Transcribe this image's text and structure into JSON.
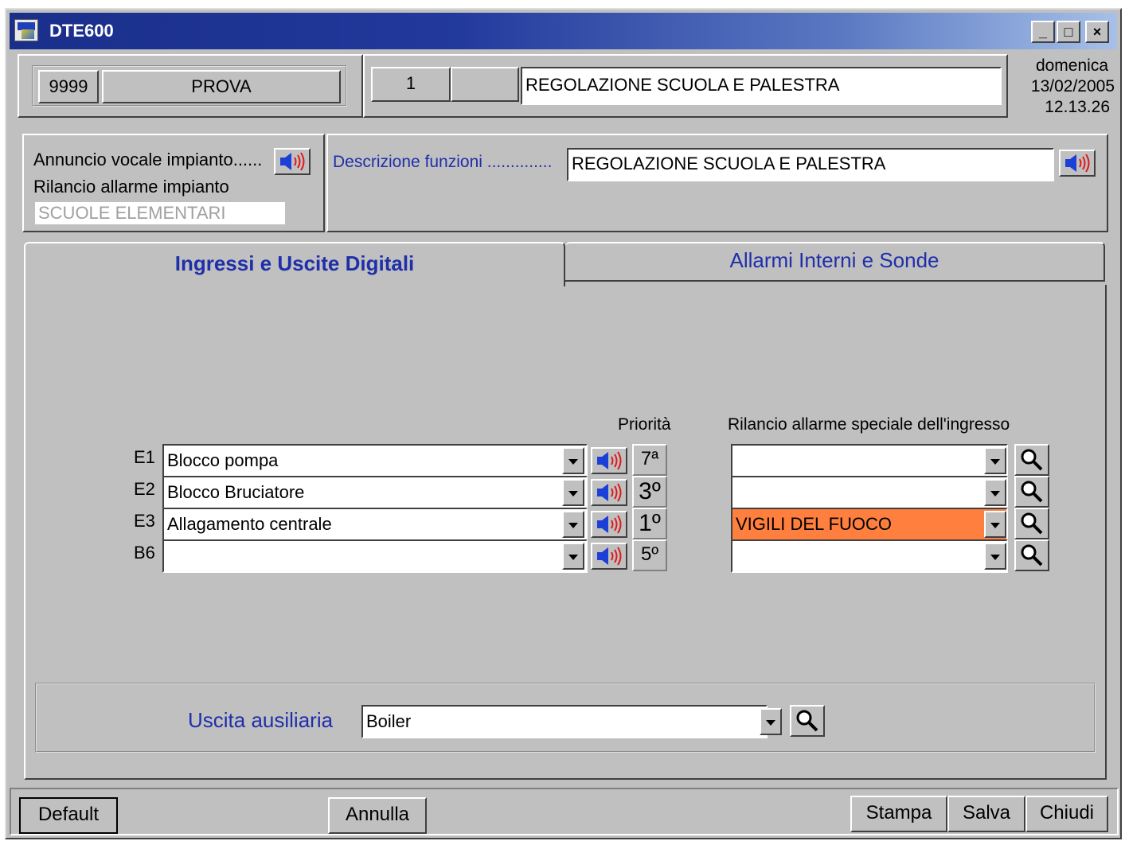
{
  "window": {
    "title": "DTE600",
    "minimize": "_",
    "maximize": "□",
    "close": "×"
  },
  "header": {
    "code": "9999",
    "name": "PROVA",
    "number": "1",
    "empty_field": "",
    "description": "REGOLAZIONE SCUOLA E PALESTRA",
    "day": "domenica",
    "date": "13/02/2005",
    "time": "12.13.26"
  },
  "info": {
    "voice_label": "Annuncio vocale impianto......",
    "relay_label": "Rilancio allarme impianto",
    "relay_value": "SCUOLE ELEMENTARI",
    "func_label": "Descrizione funzioni ..............",
    "func_value": "REGOLAZIONE SCUOLA E PALESTRA"
  },
  "tabs": [
    {
      "label": "Ingressi e Uscite Digitali",
      "active": true
    },
    {
      "label": "Allarmi Interni e Sonde",
      "active": false
    }
  ],
  "inputs": {
    "priority_header": "Priorità",
    "special_header": "Rilancio allarme speciale dell'ingresso",
    "rows": [
      {
        "id": "E1",
        "value": "Blocco pompa",
        "priority": "7ª",
        "special": ""
      },
      {
        "id": "E2",
        "value": "Blocco Bruciatore",
        "priority": "3º",
        "special": ""
      },
      {
        "id": "E3",
        "value": "Allagamento centrale",
        "priority": "1º",
        "special": "VIGILI DEL FUOCO"
      },
      {
        "id": "B6",
        "value": "",
        "priority": "5º",
        "special": ""
      }
    ]
  },
  "aux": {
    "label": "Uscita ausiliaria",
    "value": "Boiler"
  },
  "buttons": {
    "default": "Default",
    "annulla": "Annulla",
    "stampa": "Stampa",
    "salva": "Salva",
    "chiudi": "Chiudi"
  },
  "colors": {
    "title_gradient_start": "#1a2f8a",
    "title_gradient_end": "#a6c0e8",
    "highlight_orange": "#ff7f3f",
    "label_blue": "#1f2faa",
    "window_gray": "#c0c0c0"
  }
}
